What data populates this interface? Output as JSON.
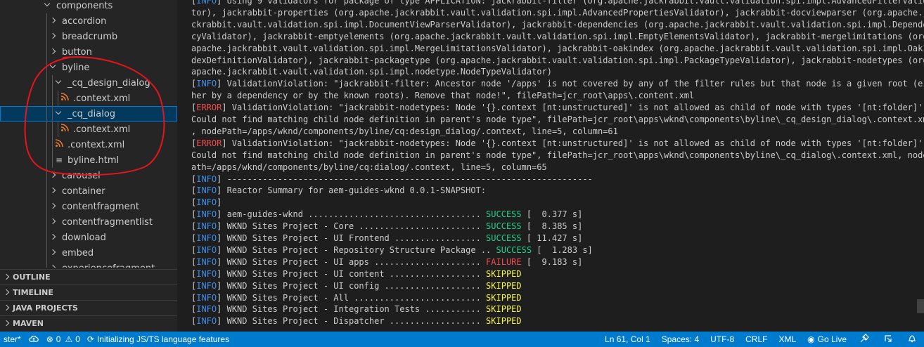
{
  "explorer": {
    "rows": [
      {
        "label": "components",
        "type": "folder",
        "expanded": true
      },
      {
        "label": "accordion",
        "type": "folder",
        "expanded": false
      },
      {
        "label": "breadcrumb",
        "type": "folder",
        "expanded": false
      },
      {
        "label": "button",
        "type": "folder",
        "expanded": false
      },
      {
        "label": "byline",
        "type": "folder",
        "expanded": true
      },
      {
        "label": "_cq_design_dialog",
        "type": "folder",
        "expanded": true
      },
      {
        "label": ".context.xml",
        "type": "xml"
      },
      {
        "label": "_cq_dialog",
        "type": "folder",
        "expanded": true,
        "selected": true
      },
      {
        "label": ".context.xml",
        "type": "xml"
      },
      {
        "label": ".context.xml",
        "type": "xml"
      },
      {
        "label": "byline.html",
        "type": "html"
      },
      {
        "label": "carousel",
        "type": "folder",
        "expanded": false
      },
      {
        "label": "container",
        "type": "folder",
        "expanded": false
      },
      {
        "label": "contentfragment",
        "type": "folder",
        "expanded": false
      },
      {
        "label": "contentfragmentlist",
        "type": "folder",
        "expanded": false
      },
      {
        "label": "download",
        "type": "folder",
        "expanded": false
      },
      {
        "label": "embed",
        "type": "folder",
        "expanded": false
      },
      {
        "label": "experiencefragment",
        "type": "folder",
        "expanded": false
      }
    ]
  },
  "panels": [
    "OUTLINE",
    "TIMELINE",
    "JAVA PROJECTS",
    "MAVEN"
  ],
  "terminal": {
    "lines": [
      [
        {
          "t": "[",
          "c": ""
        },
        {
          "t": "INFO",
          "c": "info"
        },
        {
          "t": "] Using 9 validators for package of type APPLICATION: jackrabbit-filter (org.apache.jackrabbit.vault.validation.spi.impl.AdvancedFilterValida",
          "c": ""
        }
      ],
      [
        {
          "t": "tor), jackrabbit-properties (org.apache.jackrabbit.vault.validation.spi.impl.AdvancedPropertiesValidator), jackrabbit-docviewparser (org.apache.ja",
          "c": ""
        }
      ],
      [
        {
          "t": "ckrabbit.vault.validation.spi.impl.DocumentViewParserValidator), jackrabbit-dependencies (org.apache.jackrabbit.vault.validation.spi.impl.Dependen",
          "c": ""
        }
      ],
      [
        {
          "t": "cyValidator), jackrabbit-emptyelements (org.apache.jackrabbit.vault.validation.spi.impl.EmptyElementsValidator), jackrabbit-mergelimitations (org.",
          "c": ""
        }
      ],
      [
        {
          "t": "apache.jackrabbit.vault.validation.spi.impl.MergeLimitationsValidator), jackrabbit-oakindex (org.apache.jackrabbit.vault.validation.spi.impl.OakIn",
          "c": ""
        }
      ],
      [
        {
          "t": "dexDefinitionValidator), jackrabbit-packagetype (org.apache.jackrabbit.vault.validation.spi.impl.PackageTypeValidator), jackrabbit-nodetypes (org.",
          "c": ""
        }
      ],
      [
        {
          "t": "apache.jackrabbit.vault.validation.spi.impl.nodetype.NodeTypeValidator)",
          "c": ""
        }
      ],
      [
        {
          "t": "[",
          "c": ""
        },
        {
          "t": "INFO",
          "c": "info"
        },
        {
          "t": "] ValidationViolation: \"jackrabbit-filter: Ancestor node '/apps' is not covered by any of the filter rules but that node is a given root (eit",
          "c": ""
        }
      ],
      [
        {
          "t": "her by a dependency or by the known roots). Remove that node!\", filePath=jcr_root\\apps\\.content.xml",
          "c": ""
        }
      ],
      [
        {
          "t": "[",
          "c": ""
        },
        {
          "t": "ERROR",
          "c": "error"
        },
        {
          "t": "] ValidationViolation: \"jackrabbit-nodetypes: Node '{}.context [nt:unstructured]' is not allowed as child of node with types '[nt:folder]':",
          "c": ""
        }
      ],
      [
        {
          "t": "Could not find matching child node definition in parent's node type\", filePath=jcr_root\\apps\\wknd\\components\\byline\\_cq_design_dialog\\.context.xml",
          "c": ""
        }
      ],
      [
        {
          "t": ", nodePath=/apps/wknd/components/byline/cq:design_dialog/.context, line=5, column=61",
          "c": ""
        }
      ],
      [
        {
          "t": "[",
          "c": ""
        },
        {
          "t": "ERROR",
          "c": "error"
        },
        {
          "t": "] ValidationViolation: \"jackrabbit-nodetypes: Node '{}.context [nt:unstructured]' is not allowed as child of node with types '[nt:folder]':",
          "c": ""
        }
      ],
      [
        {
          "t": "Could not find matching child node definition in parent's node type\", filePath=jcr_root\\apps\\wknd\\components\\byline\\_cq_dialog\\.context.xml, nodeP",
          "c": ""
        }
      ],
      [
        {
          "t": "ath=/apps/wknd/components/byline/cq:dialog/.context, line=5, column=65",
          "c": ""
        }
      ],
      [
        {
          "t": "[",
          "c": ""
        },
        {
          "t": "INFO",
          "c": "info"
        },
        {
          "t": "] ------------------------------------------------------------------------",
          "c": ""
        }
      ],
      [
        {
          "t": "[",
          "c": ""
        },
        {
          "t": "INFO",
          "c": "info"
        },
        {
          "t": "] Reactor Summary for aem-guides-wknd 0.0.1-SNAPSHOT:",
          "c": ""
        }
      ],
      [
        {
          "t": "[",
          "c": ""
        },
        {
          "t": "INFO",
          "c": "info"
        },
        {
          "t": "]",
          "c": ""
        }
      ],
      [
        {
          "t": "[",
          "c": ""
        },
        {
          "t": "INFO",
          "c": "info"
        },
        {
          "t": "] aem-guides-wknd .................................. ",
          "c": ""
        },
        {
          "t": "SUCCESS",
          "c": "success"
        },
        {
          "t": " [  0.377 s]",
          "c": ""
        }
      ],
      [
        {
          "t": "[",
          "c": ""
        },
        {
          "t": "INFO",
          "c": "info"
        },
        {
          "t": "] WKND Sites Project - Core ........................ ",
          "c": ""
        },
        {
          "t": "SUCCESS",
          "c": "success"
        },
        {
          "t": " [  8.385 s]",
          "c": ""
        }
      ],
      [
        {
          "t": "[",
          "c": ""
        },
        {
          "t": "INFO",
          "c": "info"
        },
        {
          "t": "] WKND Sites Project - UI Frontend ................. ",
          "c": ""
        },
        {
          "t": "SUCCESS",
          "c": "success"
        },
        {
          "t": " [ 11.427 s]",
          "c": ""
        }
      ],
      [
        {
          "t": "[",
          "c": ""
        },
        {
          "t": "INFO",
          "c": "info"
        },
        {
          "t": "] WKND Sites Project - Repository Structure Package .. ",
          "c": ""
        },
        {
          "t": "SUCCESS",
          "c": "success"
        },
        {
          "t": " [  1.283 s]",
          "c": ""
        }
      ],
      [
        {
          "t": "[",
          "c": ""
        },
        {
          "t": "INFO",
          "c": "info"
        },
        {
          "t": "] WKND Sites Project - UI apps ..................... ",
          "c": ""
        },
        {
          "t": "FAILURE",
          "c": "failure"
        },
        {
          "t": " [  9.183 s]",
          "c": ""
        }
      ],
      [
        {
          "t": "[",
          "c": ""
        },
        {
          "t": "INFO",
          "c": "info"
        },
        {
          "t": "] WKND Sites Project - UI content .................. ",
          "c": ""
        },
        {
          "t": "SKIPPED",
          "c": "skipped"
        }
      ],
      [
        {
          "t": "[",
          "c": ""
        },
        {
          "t": "INFO",
          "c": "info"
        },
        {
          "t": "] WKND Sites Project - UI config ................... ",
          "c": ""
        },
        {
          "t": "SKIPPED",
          "c": "skipped"
        }
      ],
      [
        {
          "t": "[",
          "c": ""
        },
        {
          "t": "INFO",
          "c": "info"
        },
        {
          "t": "] WKND Sites Project - All ......................... ",
          "c": ""
        },
        {
          "t": "SKIPPED",
          "c": "skipped"
        }
      ],
      [
        {
          "t": "[",
          "c": ""
        },
        {
          "t": "INFO",
          "c": "info"
        },
        {
          "t": "] WKND Sites Project - Integration Tests ........... ",
          "c": ""
        },
        {
          "t": "SKIPPED",
          "c": "skipped"
        }
      ],
      [
        {
          "t": "[",
          "c": ""
        },
        {
          "t": "INFO",
          "c": "info"
        },
        {
          "t": "] WKND Sites Project - Dispatcher .................. ",
          "c": ""
        },
        {
          "t": "SKIPPED",
          "c": "skipped"
        }
      ]
    ]
  },
  "statusbar": {
    "branch": "ster*",
    "sync_icon": "cloud-sync-icon",
    "errors": "0",
    "warnings": "0",
    "task": "Initializing JS/TS language features",
    "position": "Ln 61, Col 1",
    "spaces": "Spaces: 4",
    "encoding": "UTF-8",
    "eol": "CRLF",
    "language": "XML",
    "golive": "Go Live"
  },
  "colors": {
    "statusbar": "#007acc",
    "sidebar": "#252526",
    "terminal": "#1e1e1e",
    "annotation": "#e8141c"
  }
}
